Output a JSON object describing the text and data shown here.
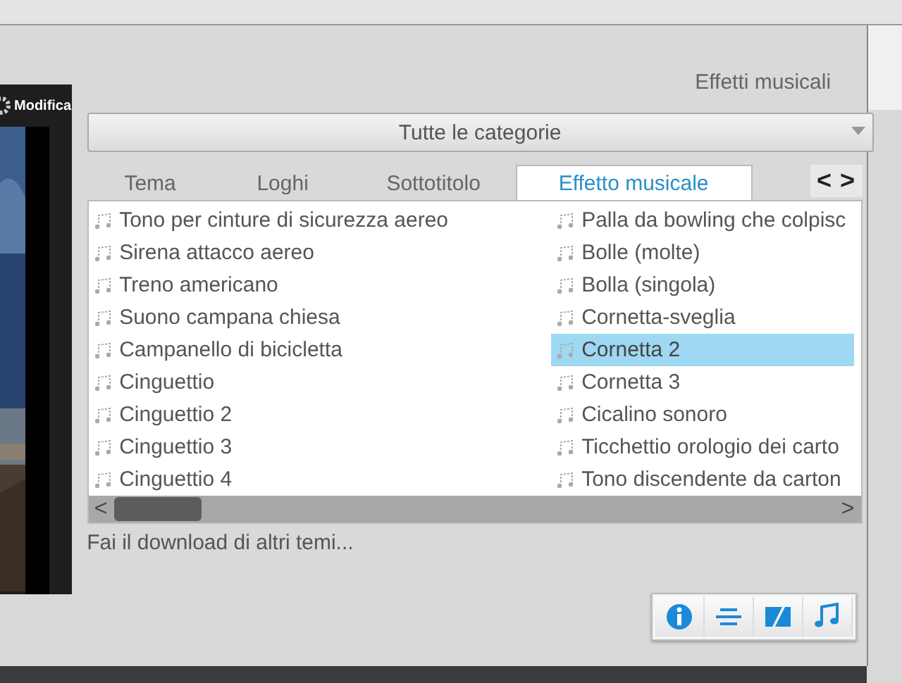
{
  "preview": {
    "edit_label": "Modifica"
  },
  "panel_title": "Effetti musicali",
  "category_dropdown": {
    "value": "Tutte le categorie"
  },
  "tabs": [
    {
      "label": "Tema",
      "selected": false
    },
    {
      "label": "Loghi",
      "selected": false
    },
    {
      "label": "Sottotitolo",
      "selected": false
    },
    {
      "label": "Effetto musicale",
      "selected": true
    }
  ],
  "tab_nav": {
    "prev": "<",
    "next": ">"
  },
  "effects": [
    {
      "label": "Tono per cinture di sicurezza aereo",
      "selected": false
    },
    {
      "label": "Sirena attacco aereo",
      "selected": false
    },
    {
      "label": "Treno americano",
      "selected": false
    },
    {
      "label": "Suono campana chiesa",
      "selected": false
    },
    {
      "label": "Campanello di bicicletta",
      "selected": false
    },
    {
      "label": "Cinguettio",
      "selected": false
    },
    {
      "label": "Cinguettio 2",
      "selected": false
    },
    {
      "label": "Cinguettio 3",
      "selected": false
    },
    {
      "label": "Cinguettio 4",
      "selected": false
    },
    {
      "label": "Palla da bowling che colpisc",
      "selected": false
    },
    {
      "label": "Bolle (molte)",
      "selected": false
    },
    {
      "label": "Bolla (singola)",
      "selected": false
    },
    {
      "label": "Cornetta-sveglia",
      "selected": false
    },
    {
      "label": "Cornetta 2",
      "selected": true
    },
    {
      "label": "Cornetta 3",
      "selected": false
    },
    {
      "label": "Cicalino sonoro",
      "selected": false
    },
    {
      "label": "Ticchettio orologio dei carto",
      "selected": false
    },
    {
      "label": "Tono discendente da carton",
      "selected": false
    }
  ],
  "scrollbar": {
    "left": "<",
    "right": ">"
  },
  "download_link": "Fai il download di altri temi...",
  "toolbar": [
    {
      "kind": "info"
    },
    {
      "kind": "subtitle"
    },
    {
      "kind": "transition"
    },
    {
      "kind": "music"
    }
  ]
}
